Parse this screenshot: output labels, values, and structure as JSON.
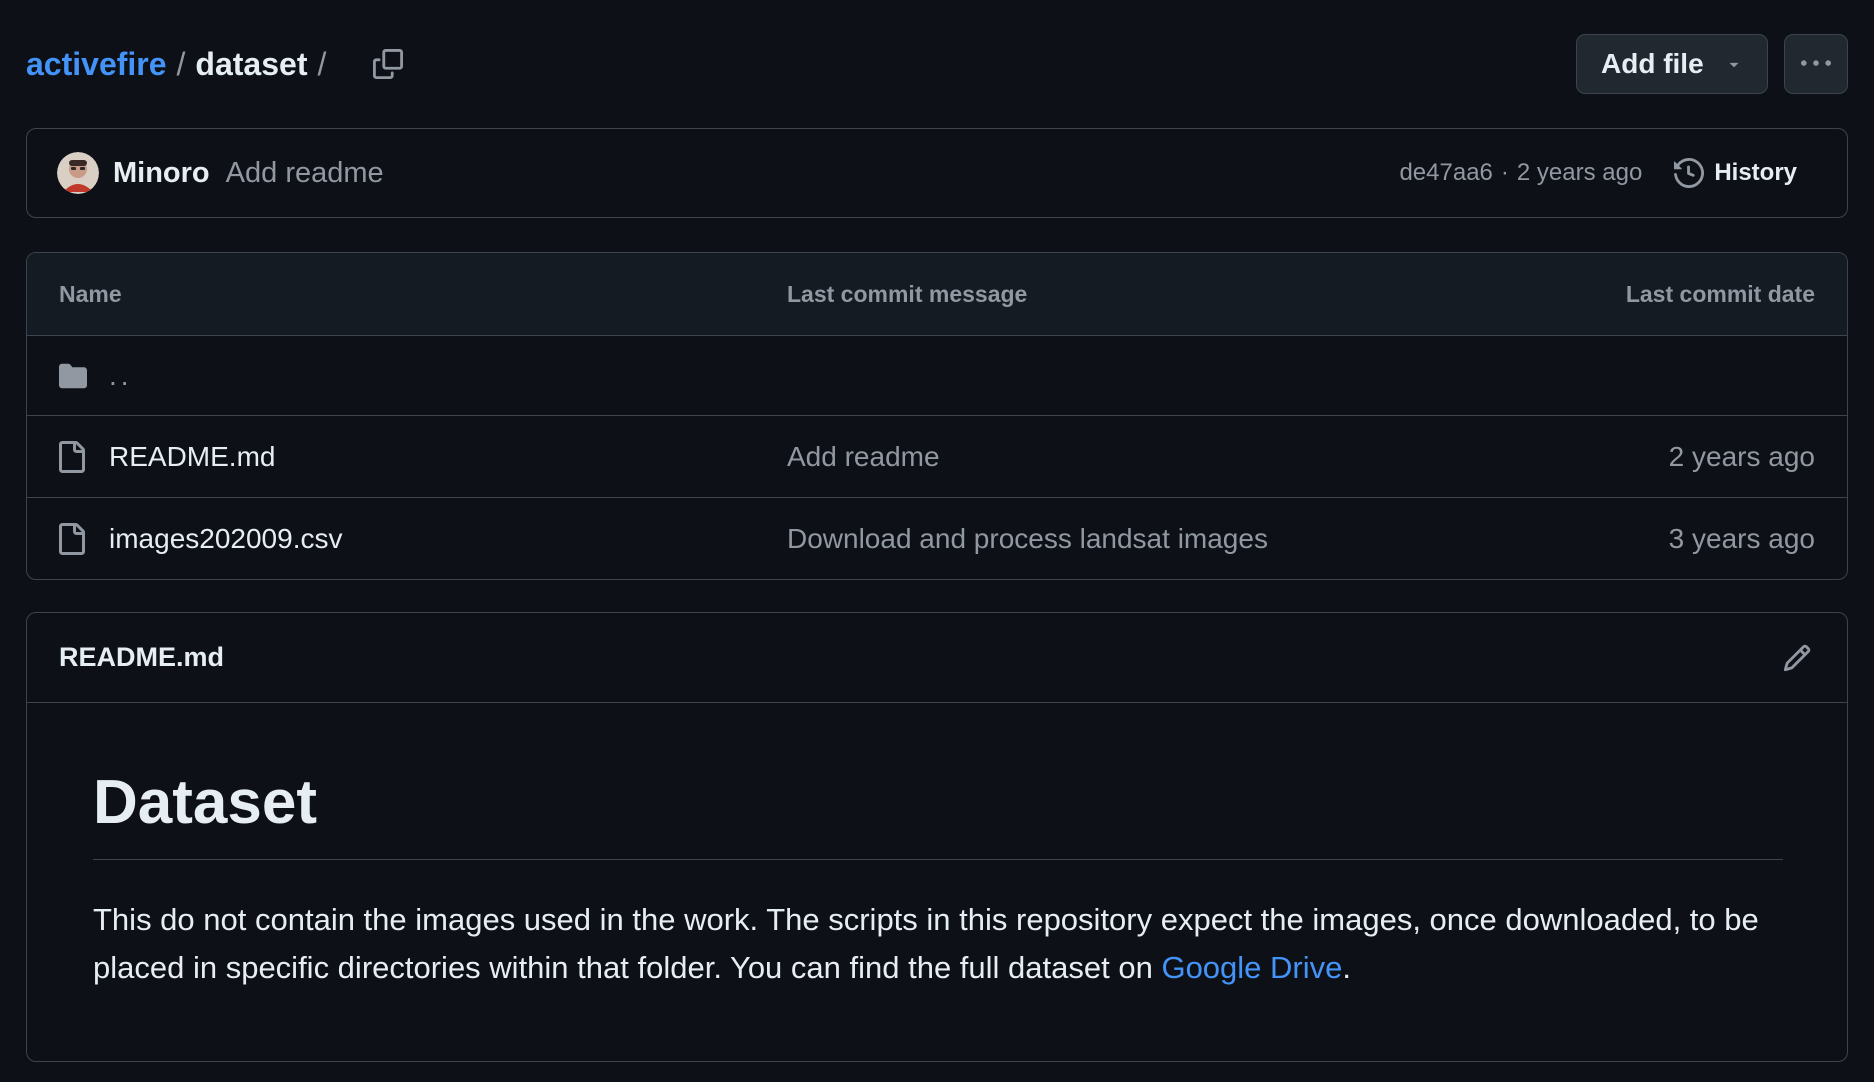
{
  "breadcrumb": {
    "repo": "activefire",
    "separator": "/",
    "folder": "dataset",
    "trailing_separator": "/"
  },
  "header_actions": {
    "add_file_label": "Add file",
    "more_label": "···"
  },
  "latest_commit": {
    "author": "Minoro",
    "message": "Add readme",
    "sha": "de47aa6",
    "dot": "·",
    "age": "2 years ago",
    "history_label": "History"
  },
  "file_table": {
    "columns": [
      "Name",
      "Last commit message",
      "Last commit date"
    ],
    "parent_label": "..",
    "rows": [
      {
        "name": "README.md",
        "message": "Add readme",
        "date": "2 years ago"
      },
      {
        "name": "images202009.csv",
        "message": "Download and process landsat images",
        "date": "3 years ago"
      }
    ]
  },
  "readme": {
    "filename": "README.md",
    "heading": "Dataset",
    "paragraph_text": "This do not contain the images used in the work. The scripts in this repository expect the images, once downloaded, to be placed in specific directories within that folder. You can find the full dataset on ",
    "link_text": "Google Drive",
    "paragraph_end": "."
  },
  "icons": {
    "copy": "copy-icon",
    "caret": "triangle-down-icon",
    "kebab": "kebab-horizontal-icon",
    "history": "history-icon",
    "folder": "folder-icon",
    "file": "file-icon",
    "edit": "pencil-icon"
  },
  "colors": {
    "background": "#0d1117",
    "link": "#4493f8",
    "muted": "#9198a1",
    "border": "#3d444d",
    "text": "#e6edf3"
  }
}
